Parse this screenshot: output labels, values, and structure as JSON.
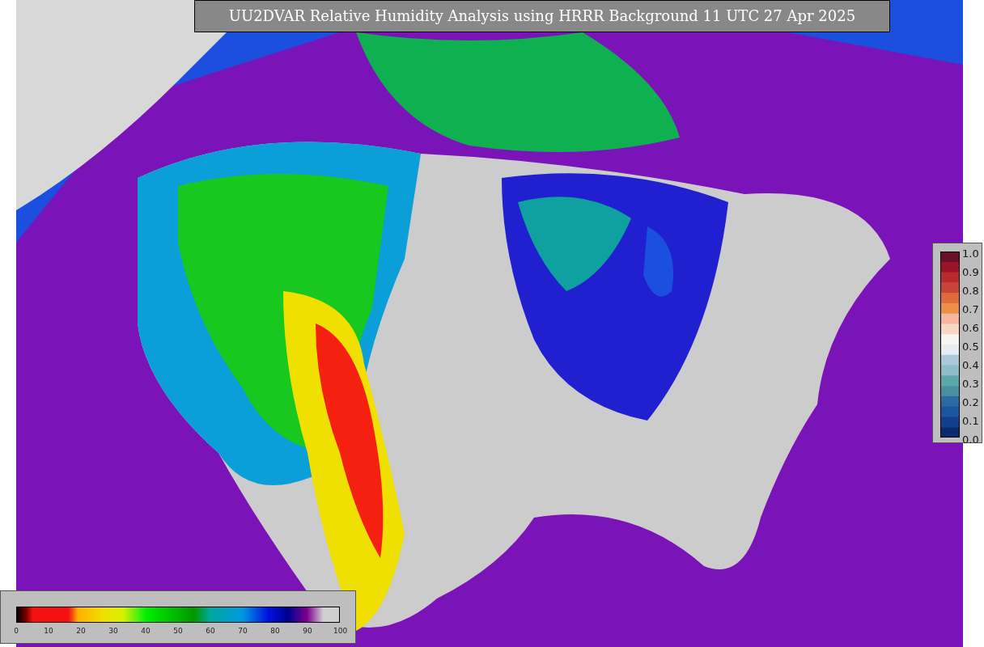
{
  "title": "UU2DVAR Relative Humidity Analysis using HRRR Background 11 UTC 27 Apr 2025",
  "ratio_legend": {
    "ticks": [
      "1.0",
      "0.9",
      "0.8",
      "0.7",
      "0.6",
      "0.5",
      "0.4",
      "0.3",
      "0.2",
      "0.1",
      "0.0"
    ]
  },
  "humidity_legend": {
    "ticks": [
      "0",
      "10",
      "20",
      "30",
      "40",
      "50",
      "60",
      "70",
      "80",
      "90",
      "100"
    ]
  }
}
